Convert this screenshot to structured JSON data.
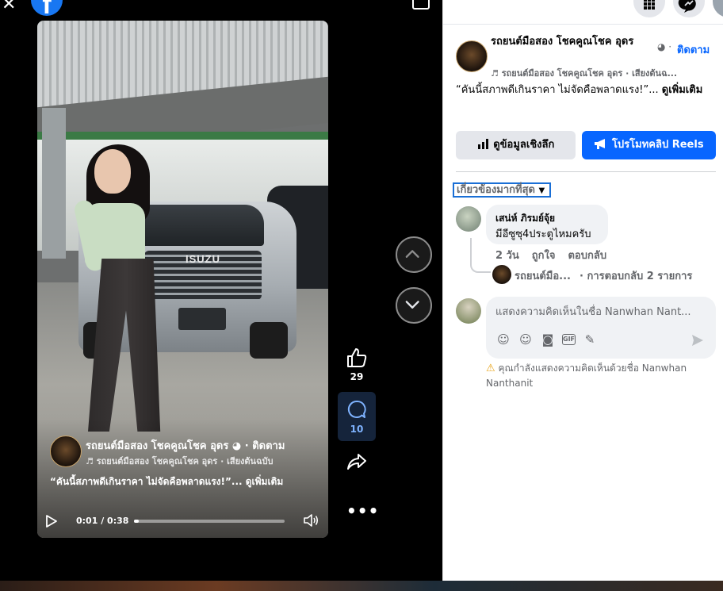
{
  "viewer": {
    "like_count": "29",
    "comment_count": "10",
    "progress_fraction": 0.03
  },
  "video": {
    "page_name": "รถยนต์มือสอง โชคคูณโชค อุดร",
    "follow_label": "ติดตาม",
    "audio": "รถยนต์มือสอง โชคคูณโชค อุดร · เสียงต้นฉบับ",
    "caption": "“คันนี้สภาพดีเกินราคา ไม่จัดคือพลาดแรง!”... ดูเพิ่มเติม",
    "time": "0:01 / 0:38",
    "badge": "ISUZU"
  },
  "panel": {
    "page_name": "รถยนต์มือสอง โชคคูณโชค อุดร",
    "follow_label": "ติดตาม",
    "audio": "รถยนต์มือสอง โชคคูณโชค อุดร · เสียงต้นฉ...",
    "caption": "“คันนี้สภาพดีเกินราคา ไม่จัดคือพลาดแรง!”...",
    "see_more": "ดูเพิ่มเติม",
    "insights_label": "ดูข้อมูลเชิงลึก",
    "promote_label": "โปรโมทคลิป Reels",
    "sort_label": "เกี่ยวข้องมากที่สุด"
  },
  "comment": {
    "author": "เสน่ห์ ภิรมย์จุ้ย",
    "text": "มีอีซูซุ4ประตูไหมครับ",
    "time": "2 วัน",
    "like_label": "ถูกใจ",
    "reply_label": "ตอบกลับ",
    "reply_author": "รถยนต์มือ...",
    "reply_count": "· การตอบกลับ 2 รายการ"
  },
  "composer": {
    "placeholder": "แสดงความคิดเห็นในชื่อ Nanwhan Nant...",
    "gif_label": "GIF",
    "notice": "คุณกำลังแสดงความคิดเห็นด้วยชื่อ Nanwhan Nanthanit"
  },
  "colors": {
    "accent": "#0866ff",
    "comment_active_bg": "#15243b",
    "comment_active_text": "#7fb3ff"
  },
  "icons": [
    "close-icon",
    "facebook-logo",
    "pip-icon",
    "chevron-up-icon",
    "chevron-down-icon",
    "like-icon",
    "comment-icon",
    "share-icon",
    "more-icon",
    "play-icon",
    "volume-icon",
    "globe-icon",
    "music-note-icon",
    "insights-icon",
    "megaphone-icon",
    "caret-down-icon",
    "avatar-icon",
    "emoji-icon",
    "camera-icon",
    "gif-icon",
    "sticker-icon",
    "send-icon",
    "warning-icon"
  ]
}
